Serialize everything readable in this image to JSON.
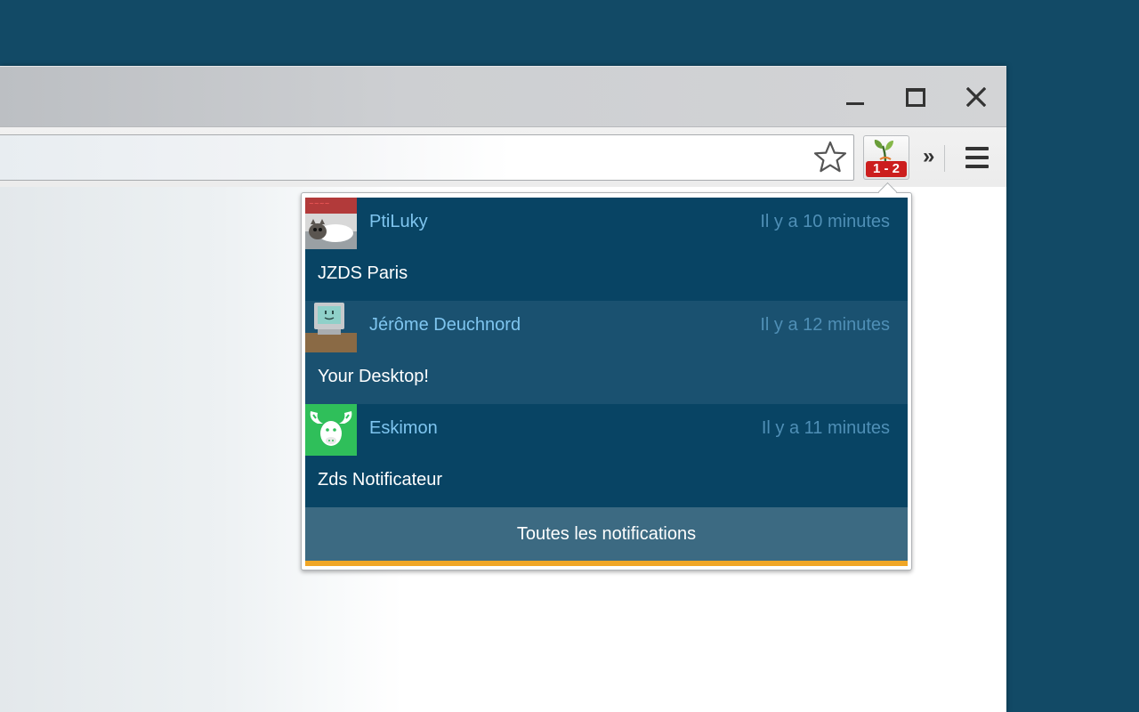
{
  "window_controls": {
    "minimize": "minimize",
    "maximize": "maximize",
    "close": "close"
  },
  "extension": {
    "badge_text": "1 - 2",
    "icon": "sprout-icon"
  },
  "toolbar": {
    "chevron": "»"
  },
  "notifications": [
    {
      "author": "PtiLuky",
      "time": "Il y a 10 minutes",
      "subject": "JZDS Paris",
      "avatar_icon": "cat-avatar"
    },
    {
      "author": "Jérôme Deuchnord",
      "time": "Il y a 12 minutes",
      "subject": "Your Desktop!",
      "avatar_icon": "computer-avatar"
    },
    {
      "author": "Eskimon",
      "time": "Il y a 11 minutes",
      "subject": "Zds Notificateur",
      "avatar_icon": "moose-avatar"
    }
  ],
  "footer": {
    "label": "Toutes les notifications"
  },
  "colors": {
    "desktop": "#124a66",
    "notif_dark": "#084464",
    "notif_light": "#1a5170",
    "author": "#7fc5ef",
    "time": "#4f8fb6",
    "footer": "#3c6a82",
    "accent_line": "#f0a626",
    "badge": "#cc1e1e"
  }
}
